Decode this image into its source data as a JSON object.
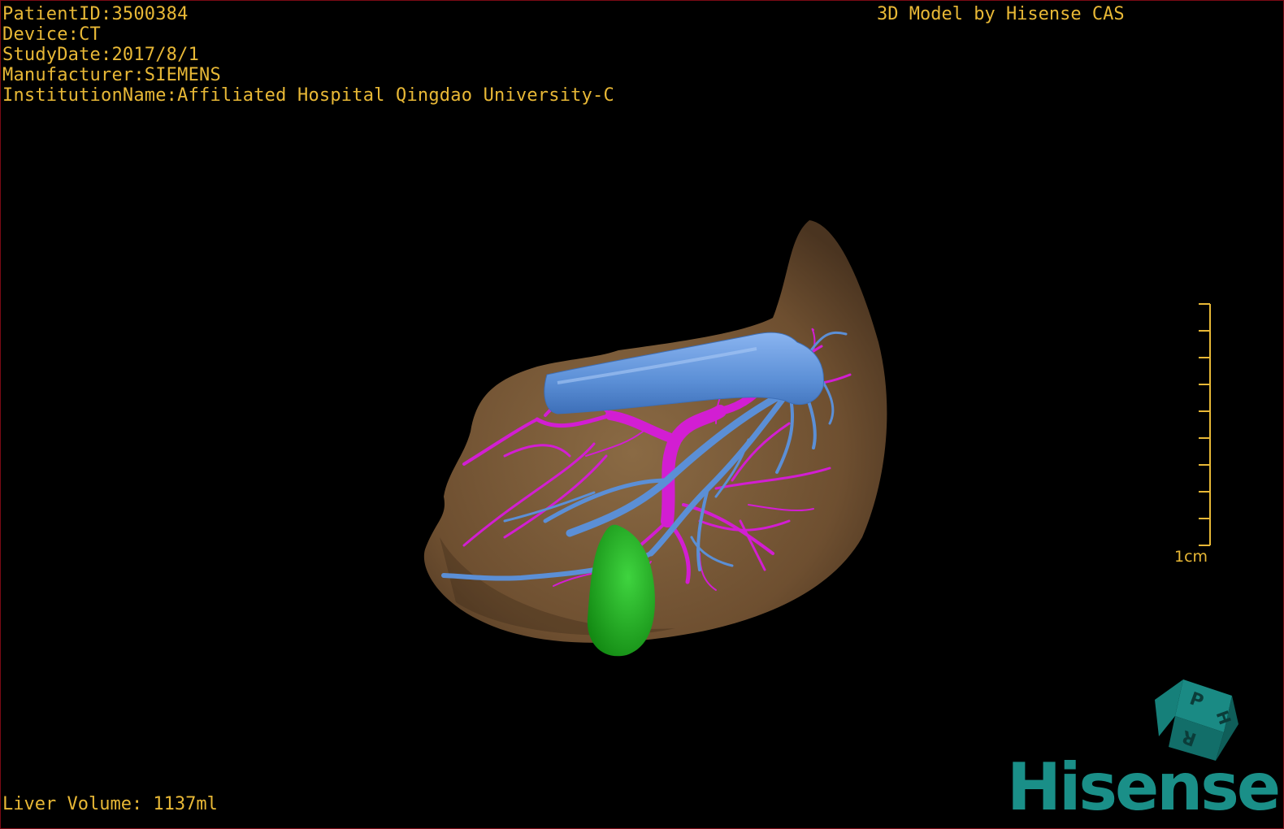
{
  "header_info": {
    "patient_id": "PatientID:3500384",
    "device": "Device:CT",
    "study_date": "StudyDate:2017/8/1",
    "manufacturer": "Manufacturer:SIEMENS",
    "institution": "InstitutionName:Affiliated Hospital Qingdao University-C"
  },
  "credit": "3D Model by Hisense CAS",
  "footer": {
    "liver_volume": "Liver Volume: 1137ml"
  },
  "scale": {
    "label": "1cm"
  },
  "orientation_cube": {
    "faces": [
      "P",
      "H",
      "R"
    ]
  },
  "brand": {
    "logo_text": "Hisense"
  },
  "colors": {
    "overlay_text": "#e8b836",
    "liver": "#7a5a36",
    "hepatic_vein": "#5b8fd6",
    "portal_vein": "#d21ed2",
    "gallbladder": "#1fa81f",
    "brand": "#1a8f88",
    "frame_border": "#7a0a14"
  }
}
